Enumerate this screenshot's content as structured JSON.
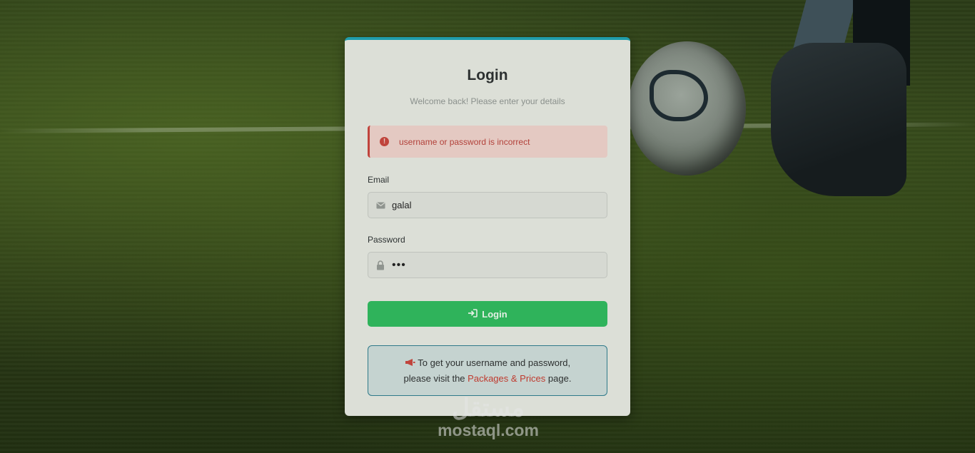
{
  "page": {
    "title": "Login",
    "subtitle": "Welcome back! Please enter your details"
  },
  "error": {
    "message": "username or password is incorrect",
    "icon": "alert-circle-icon",
    "color": "#c0443c"
  },
  "form": {
    "email_label": "Email",
    "email_value": "galal",
    "email_icon": "envelope-icon",
    "password_label": "Password",
    "password_mask": "•••",
    "password_icon": "lock-icon",
    "submit_label": "Login",
    "submit_icon": "sign-in-icon",
    "submit_color": "#2fb35b"
  },
  "info": {
    "icon": "megaphone-icon",
    "line1": "To get your username and password,",
    "line2_prefix": "please visit the",
    "link_text": "Packages & Prices",
    "line2_suffix": "page."
  },
  "watermark": {
    "arabic": "مستقل",
    "latin": "mostaql.com"
  },
  "colors": {
    "accent_top": "#1f9cab",
    "link": "#bf3a2e"
  }
}
